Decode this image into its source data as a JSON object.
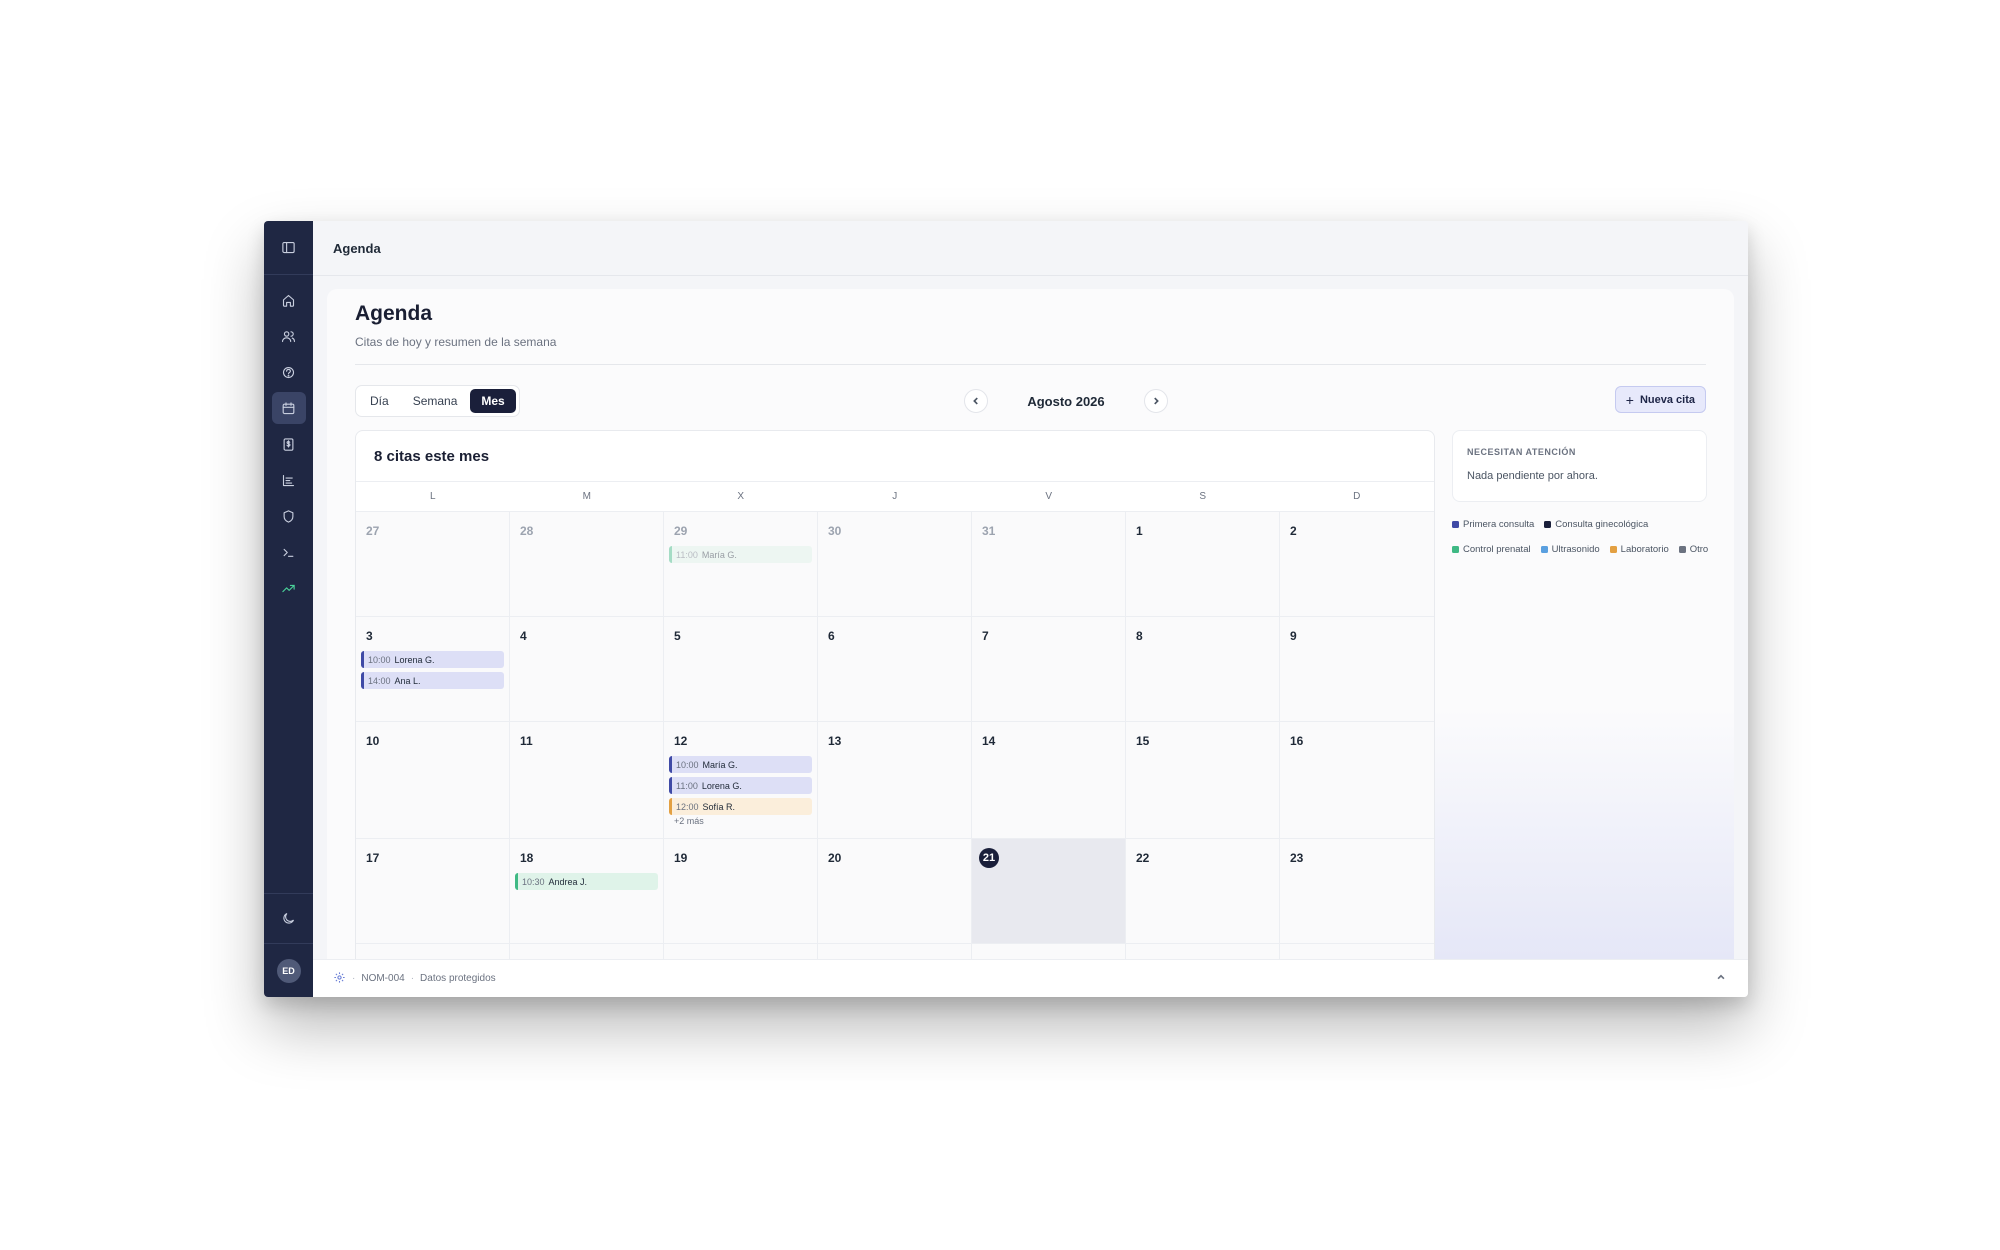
{
  "topbar": {
    "title": "Agenda"
  },
  "header": {
    "title": "Agenda",
    "subtitle": "Citas de hoy y resumen de la semana"
  },
  "view_toggle": [
    {
      "label": "Día",
      "active": false
    },
    {
      "label": "Semana",
      "active": false
    },
    {
      "label": "Mes",
      "active": true
    }
  ],
  "month_nav": {
    "label": "Agosto 2026"
  },
  "new_button": {
    "label": "Nueva cita"
  },
  "calendar": {
    "count_label": "8 citas este mes",
    "weekdays": [
      "L",
      "M",
      "X",
      "J",
      "V",
      "S",
      "D"
    ],
    "cells": [
      {
        "day": "27",
        "muted": true,
        "events": []
      },
      {
        "day": "28",
        "muted": true,
        "events": []
      },
      {
        "day": "29",
        "muted": true,
        "events": [
          {
            "time": "11:00",
            "name": "María G.",
            "type": "green",
            "faded": true
          }
        ]
      },
      {
        "day": "30",
        "muted": true,
        "events": []
      },
      {
        "day": "31",
        "muted": true,
        "events": []
      },
      {
        "day": "1",
        "events": []
      },
      {
        "day": "2",
        "events": []
      },
      {
        "day": "3",
        "events": [
          {
            "time": "10:00",
            "name": "Lorena G.",
            "type": "purple"
          },
          {
            "time": "14:00",
            "name": "Ana L.",
            "type": "purple"
          }
        ]
      },
      {
        "day": "4",
        "events": []
      },
      {
        "day": "5",
        "events": []
      },
      {
        "day": "6",
        "events": []
      },
      {
        "day": "7",
        "events": []
      },
      {
        "day": "8",
        "events": []
      },
      {
        "day": "9",
        "events": []
      },
      {
        "day": "10",
        "events": []
      },
      {
        "day": "11",
        "events": []
      },
      {
        "day": "12",
        "events": [
          {
            "time": "10:00",
            "name": "María G.",
            "type": "purple"
          },
          {
            "time": "11:00",
            "name": "Lorena G.",
            "type": "purple"
          },
          {
            "time": "12:00",
            "name": "Sofía R.",
            "type": "orange"
          }
        ],
        "more": "+2 más"
      },
      {
        "day": "13",
        "events": []
      },
      {
        "day": "14",
        "events": []
      },
      {
        "day": "15",
        "events": []
      },
      {
        "day": "16",
        "events": []
      },
      {
        "day": "17",
        "events": []
      },
      {
        "day": "18",
        "events": [
          {
            "time": "10:30",
            "name": "Andrea J.",
            "type": "green"
          }
        ]
      },
      {
        "day": "19",
        "events": []
      },
      {
        "day": "20",
        "events": []
      },
      {
        "day": "21",
        "today": true,
        "events": []
      },
      {
        "day": "22",
        "events": []
      },
      {
        "day": "23",
        "events": []
      }
    ]
  },
  "attention": {
    "title": "NECESITAN ATENCIÓN",
    "text": "Nada pendiente por ahora."
  },
  "legend": [
    {
      "label": "Primera consulta",
      "color": "#3f4aa6"
    },
    {
      "label": "Consulta ginecológica",
      "color": "#1a1f3a"
    },
    {
      "label": "Control prenatal",
      "color": "#3fb984"
    },
    {
      "label": "Ultrasonido",
      "color": "#5aa0e0"
    },
    {
      "label": "Laboratorio",
      "color": "#e3a042"
    },
    {
      "label": "Otro",
      "color": "#6b7280"
    }
  ],
  "footer": {
    "code": "NOM-004",
    "text": "Datos protegidos"
  },
  "user": {
    "initials": "ED"
  },
  "sidebar": {
    "items": [
      {
        "icon": "home-icon",
        "active": false
      },
      {
        "icon": "users-icon",
        "active": false
      },
      {
        "icon": "stethoscope-icon",
        "active": false
      },
      {
        "icon": "calendar-icon",
        "active": true
      },
      {
        "icon": "billing-icon",
        "active": false
      },
      {
        "icon": "chart-icon",
        "active": false
      },
      {
        "icon": "shield-icon",
        "active": false
      },
      {
        "icon": "terminal-icon",
        "active": false
      },
      {
        "icon": "trending-icon",
        "active": false
      }
    ]
  }
}
